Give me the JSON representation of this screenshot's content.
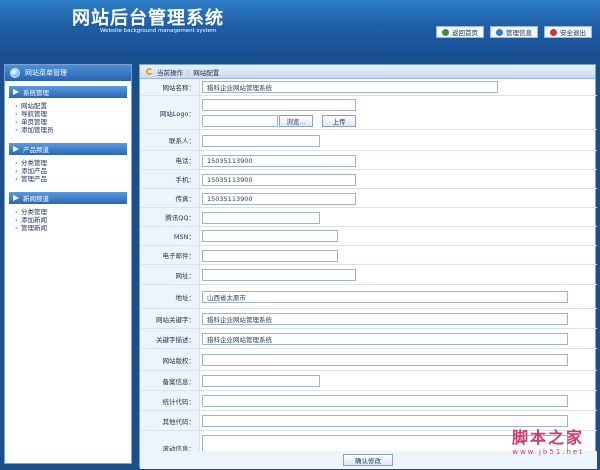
{
  "header": {
    "title": "网站后台管理系统",
    "subtitle": "Website background management system",
    "nav": [
      {
        "label": "返回首页",
        "icon": "home-icon"
      },
      {
        "label": "管理信息",
        "icon": "info-icon"
      },
      {
        "label": "安全退出",
        "icon": "exit-icon"
      }
    ]
  },
  "sidebar": {
    "title": "网站菜单管理",
    "groups": [
      {
        "title": "系统管理",
        "items": [
          "网站配置",
          "导航管理",
          "单页管理",
          "添加管理员"
        ]
      },
      {
        "title": "产品频道",
        "items": [
          "分类管理",
          "添加产品",
          "管理产品"
        ]
      },
      {
        "title": "新闻频道",
        "items": [
          "分类管理",
          "添加新闻",
          "管理新闻"
        ]
      }
    ]
  },
  "breadcrumb": {
    "current_op": "当前操作",
    "page": "网站配置"
  },
  "form": {
    "fields": [
      {
        "label": "网站名称：",
        "value": "猎科企业网站管理系统"
      },
      {
        "label": "网站Logo：",
        "value": ""
      },
      {
        "label": "联系人：",
        "value": ""
      },
      {
        "label": "电话：",
        "value": "15035113900"
      },
      {
        "label": "手机：",
        "value": "15035113900"
      },
      {
        "label": "传真：",
        "value": "15035113900"
      },
      {
        "label": "腾讯QQ：",
        "value": ""
      },
      {
        "label": "MSN：",
        "value": ""
      },
      {
        "label": "电子邮件：",
        "value": ""
      },
      {
        "label": "网址：",
        "value": ""
      },
      {
        "label": "地址：",
        "value": "山西省太原市"
      },
      {
        "label": "网站关键字：",
        "value": "猎科企业网站管理系统"
      },
      {
        "label": "关键字描述：",
        "value": "猎科企业网站管理系统"
      },
      {
        "label": "网站版权：",
        "value": ""
      },
      {
        "label": "备案信息：",
        "value": ""
      },
      {
        "label": "统计代码：",
        "value": ""
      },
      {
        "label": "其他代码：",
        "value": ""
      },
      {
        "label": "滚动信息：",
        "value": ""
      }
    ],
    "browse_label": "浏览...",
    "upload_label": "上传",
    "submit_label": "确认修改"
  },
  "watermark": {
    "cn": "脚本之家",
    "url": "www.jb51.net"
  },
  "colors": {
    "header_blue": "#1f5ea6",
    "side_blue": "#1a4f8c",
    "accent": "#d23a6c"
  }
}
